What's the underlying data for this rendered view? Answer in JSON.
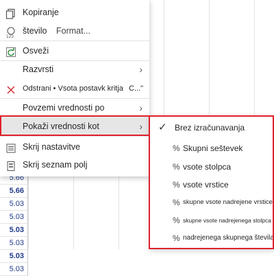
{
  "sheet": {
    "values": [
      {
        "v": "5.66",
        "bold": false
      },
      {
        "v": "5.66",
        "bold": true
      },
      {
        "v": "5.03",
        "bold": false
      },
      {
        "v": "5.03",
        "bold": false
      },
      {
        "v": "5.03",
        "bold": true
      },
      {
        "v": "5.03",
        "bold": false
      },
      {
        "v": "5.03",
        "bold": true
      },
      {
        "v": "5.03",
        "bold": false
      }
    ]
  },
  "menu": {
    "copy": "Kopiranje",
    "number": "število",
    "format": "Format...",
    "refresh": "Osveži",
    "sort": "Razvrsti",
    "remove": "Odstrani • Vsota postavk kritja",
    "remove_suffix": "C...\"",
    "summarize": "Povzemi vrednosti po",
    "show_values_as": "Pokaži vrednosti kot",
    "hide_subtotals": "Skrij nastavitve",
    "hide_field_list": "Skrij seznam polj"
  },
  "submenu": {
    "no_calculation": "Brez izračunavanja",
    "items": [
      "Skupni seštevek",
      "vsote stolpca",
      "vsote vrstice",
      "skupne vsote nadrejene vrstice",
      "skupne vsote nadrejenega stolpca",
      "nadrejenega skupnega števila"
    ],
    "percent_symbol": "%"
  },
  "colors": {
    "highlight_border": "#e0202b",
    "sheet_number": "#1f3a8a"
  }
}
